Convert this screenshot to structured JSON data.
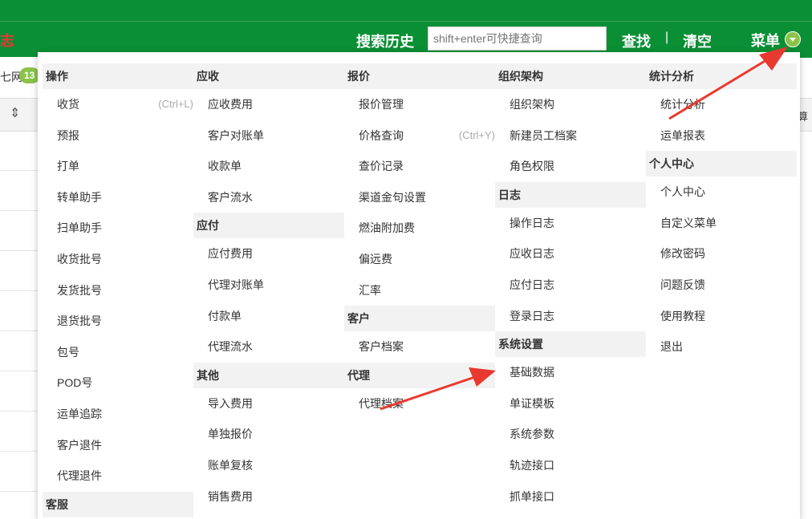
{
  "header": {
    "logo_fragment": "志",
    "search_history_label": "搜索历史",
    "search_placeholder": "shift+enter可快捷查询",
    "find_label": "查找",
    "separator": "|",
    "clear_label": "清空",
    "menu_label": "菜单"
  },
  "background": {
    "net_fragment": "七网",
    "badge": "13",
    "right_fragment": "算"
  },
  "menu": {
    "columns": [
      {
        "sections": [
          {
            "title": "操作",
            "items": [
              {
                "label": "收货",
                "shortcut": "(Ctrl+L)"
              },
              {
                "label": "预报"
              },
              {
                "label": "打单"
              },
              {
                "label": "转单助手"
              },
              {
                "label": "扫单助手"
              },
              {
                "label": "收货批号"
              },
              {
                "label": "发货批号"
              },
              {
                "label": "退货批号"
              },
              {
                "label": "包号"
              },
              {
                "label": "POD号"
              },
              {
                "label": "运单追踪"
              },
              {
                "label": "客户退件"
              },
              {
                "label": "代理退件"
              }
            ]
          },
          {
            "title": "客服",
            "items": []
          }
        ]
      },
      {
        "sections": [
          {
            "title": "应收",
            "items": [
              {
                "label": "应收费用"
              },
              {
                "label": "客户对账单"
              },
              {
                "label": "收款单"
              },
              {
                "label": "客户流水"
              }
            ]
          },
          {
            "title": "应付",
            "items": [
              {
                "label": "应付费用"
              },
              {
                "label": "代理对账单"
              },
              {
                "label": "付款单"
              },
              {
                "label": "代理流水"
              }
            ]
          },
          {
            "title": "其他",
            "items": [
              {
                "label": "导入费用"
              },
              {
                "label": "单独报价"
              },
              {
                "label": "账单复核"
              },
              {
                "label": "销售费用"
              }
            ]
          }
        ]
      },
      {
        "sections": [
          {
            "title": "报价",
            "items": [
              {
                "label": "报价管理"
              },
              {
                "label": "价格查询",
                "shortcut": "(Ctrl+Y)"
              },
              {
                "label": "查价记录"
              },
              {
                "label": "渠道金句设置"
              },
              {
                "label": "燃油附加费"
              },
              {
                "label": "偏远费"
              },
              {
                "label": "汇率"
              }
            ]
          },
          {
            "title": "客户",
            "items": [
              {
                "label": "客户档案"
              }
            ]
          },
          {
            "title": "代理",
            "items": [
              {
                "label": "代理档案"
              }
            ]
          }
        ]
      },
      {
        "sections": [
          {
            "title": "组织架构",
            "items": [
              {
                "label": "组织架构"
              },
              {
                "label": "新建员工档案"
              },
              {
                "label": "角色权限"
              }
            ]
          },
          {
            "title": "日志",
            "items": [
              {
                "label": "操作日志"
              },
              {
                "label": "应收日志"
              },
              {
                "label": "应付日志"
              },
              {
                "label": "登录日志"
              }
            ]
          },
          {
            "title": "系统设置",
            "items": [
              {
                "label": "基础数据"
              },
              {
                "label": "单证模板"
              },
              {
                "label": "系统参数"
              },
              {
                "label": "轨迹接口"
              },
              {
                "label": "抓单接口"
              }
            ]
          }
        ]
      },
      {
        "sections": [
          {
            "title": "统计分析",
            "items": [
              {
                "label": "统计分析"
              },
              {
                "label": "运单报表"
              }
            ]
          },
          {
            "title": "个人中心",
            "items": [
              {
                "label": "个人中心"
              },
              {
                "label": "自定义菜单"
              },
              {
                "label": "修改密码"
              },
              {
                "label": "问题反馈"
              },
              {
                "label": "使用教程"
              },
              {
                "label": "退出"
              }
            ]
          }
        ]
      }
    ]
  },
  "colors": {
    "header_green": "#0a8f35",
    "caret_green": "#8bc34a",
    "annotation_red": "#e8392f",
    "section_bg": "#f2f2f2"
  }
}
